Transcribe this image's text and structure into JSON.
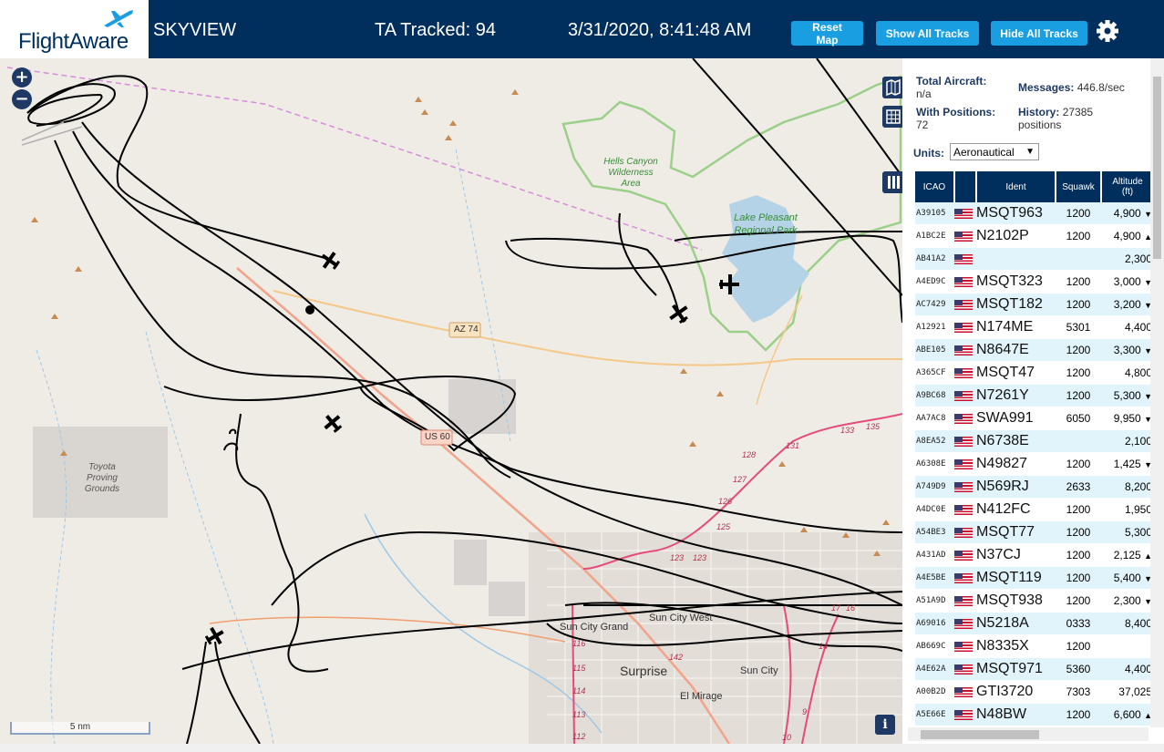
{
  "header": {
    "logo": "FlightAware",
    "title": "SKYVIEW",
    "tracked": "TA Tracked: 94",
    "datetime": "3/31/2020, 8:41:48 AM",
    "buttons": {
      "reset": "Reset Map",
      "show_all": "Show All Tracks",
      "hide_all": "Hide All Tracks"
    },
    "settings_icon": "gear-icon"
  },
  "map": {
    "zoom_in": "+",
    "zoom_out": "−",
    "scale": "5 nm",
    "info": "i",
    "labels": {
      "hells_canyon": "Hells Canyon Wilderness Area",
      "lake_pleasant": "Lake Pleasant Regional Park",
      "toyota": "Toyota Proving Grounds",
      "az74": "AZ 74",
      "us60": "US 60",
      "sun_city_grand": "Sun City Grand",
      "sun_city_west": "Sun City West",
      "surprise": "Surprise",
      "sun_city": "Sun City",
      "el_mirage": "El Mirage"
    },
    "road_numbers": [
      "128",
      "127",
      "126",
      "125",
      "123",
      "123",
      "131",
      "133",
      "135",
      "116",
      "115",
      "114",
      "113",
      "112",
      "142",
      "10",
      "9",
      "17",
      "16",
      "14"
    ],
    "colors": {
      "background": "#efece6",
      "water": "#b5d3e7",
      "park_border": "#9ccf8a",
      "highway": "#f2a38b",
      "track": "#000000"
    }
  },
  "stats": {
    "total_aircraft_label": "Total Aircraft:",
    "total_aircraft_value": "n/a",
    "with_positions_label": "With Positions:",
    "with_positions_value": "72",
    "messages_label": "Messages:",
    "messages_value": "446.8/sec",
    "history_label": "History:",
    "history_value": "27385",
    "history_unit": "positions"
  },
  "units": {
    "label": "Units:",
    "selected": "Aeronautical"
  },
  "table": {
    "headers": {
      "icao": "ICAO",
      "flag": "",
      "ident": "Ident",
      "squawk": "Squawk",
      "altitude": "Altitude",
      "altitude_unit": "(ft)"
    },
    "rows": [
      {
        "icao": "A39105",
        "ident": "MSQT963",
        "squawk": "1200",
        "altitude": "4,900",
        "trend": "▼"
      },
      {
        "icao": "A1BC2E",
        "ident": "N2102P",
        "squawk": "1200",
        "altitude": "4,900",
        "trend": "▲"
      },
      {
        "icao": "AB41A2",
        "ident": "",
        "squawk": "",
        "altitude": "2,300",
        "trend": ""
      },
      {
        "icao": "A4ED9C",
        "ident": "MSQT323",
        "squawk": "1200",
        "altitude": "3,000",
        "trend": "▼"
      },
      {
        "icao": "AC7429",
        "ident": "MSQT182",
        "squawk": "1200",
        "altitude": "3,200",
        "trend": "▼"
      },
      {
        "icao": "A12921",
        "ident": "N174ME",
        "squawk": "5301",
        "altitude": "4,400",
        "trend": ""
      },
      {
        "icao": "ABE105",
        "ident": "N8647E",
        "squawk": "1200",
        "altitude": "3,300",
        "trend": "▼"
      },
      {
        "icao": "A365CF",
        "ident": "MSQT47",
        "squawk": "1200",
        "altitude": "4,800",
        "trend": ""
      },
      {
        "icao": "A9BC68",
        "ident": "N7261Y",
        "squawk": "1200",
        "altitude": "5,300",
        "trend": "▼"
      },
      {
        "icao": "AA7AC8",
        "ident": "SWA991",
        "squawk": "6050",
        "altitude": "9,950",
        "trend": "▼"
      },
      {
        "icao": "A8EA52",
        "ident": "N6738E",
        "squawk": "",
        "altitude": "2,100",
        "trend": ""
      },
      {
        "icao": "A6308E",
        "ident": "N49827",
        "squawk": "1200",
        "altitude": "1,425",
        "trend": "▼"
      },
      {
        "icao": "A749D9",
        "ident": "N569RJ",
        "squawk": "2633",
        "altitude": "8,200",
        "trend": ""
      },
      {
        "icao": "A4DC0E",
        "ident": "N412FC",
        "squawk": "1200",
        "altitude": "1,950",
        "trend": ""
      },
      {
        "icao": "A54BE3",
        "ident": "MSQT77",
        "squawk": "1200",
        "altitude": "5,300",
        "trend": ""
      },
      {
        "icao": "A431AD",
        "ident": "N37CJ",
        "squawk": "1200",
        "altitude": "2,125",
        "trend": "▲"
      },
      {
        "icao": "A4E5BE",
        "ident": "MSQT119",
        "squawk": "1200",
        "altitude": "5,400",
        "trend": "▼"
      },
      {
        "icao": "A51A9D",
        "ident": "MSQT938",
        "squawk": "1200",
        "altitude": "2,300",
        "trend": "▼"
      },
      {
        "icao": "A69016",
        "ident": "N5218A",
        "squawk": "0333",
        "altitude": "8,400",
        "trend": ""
      },
      {
        "icao": "AB669C",
        "ident": "N8335X",
        "squawk": "1200",
        "altitude": "",
        "trend": ""
      },
      {
        "icao": "A4E62A",
        "ident": "MSQT971",
        "squawk": "5360",
        "altitude": "4,400",
        "trend": ""
      },
      {
        "icao": "A00B2D",
        "ident": "GTI3720",
        "squawk": "7303",
        "altitude": "37,025",
        "trend": ""
      },
      {
        "icao": "A5E66E",
        "ident": "N48BW",
        "squawk": "1200",
        "altitude": "6,600",
        "trend": "▲"
      }
    ]
  }
}
